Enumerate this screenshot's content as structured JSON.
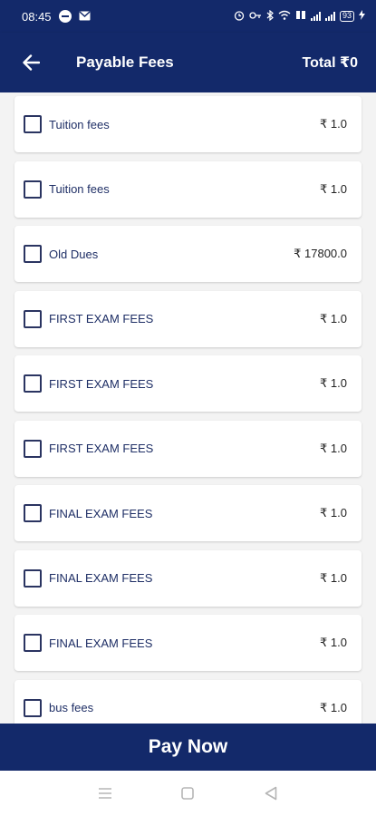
{
  "status_bar": {
    "time": "08:45",
    "battery": "93"
  },
  "header": {
    "title": "Payable Fees",
    "total": "Total ₹0"
  },
  "fees": [
    {
      "name": "Tuition fees",
      "amount": "₹ 1.0"
    },
    {
      "name": "Tuition fees",
      "amount": "₹ 1.0"
    },
    {
      "name": "Old Dues",
      "amount": "₹ 17800.0"
    },
    {
      "name": "FIRST EXAM FEES",
      "amount": "₹ 1.0"
    },
    {
      "name": "FIRST EXAM FEES",
      "amount": "₹ 1.0"
    },
    {
      "name": "FIRST EXAM FEES",
      "amount": "₹ 1.0"
    },
    {
      "name": "FINAL EXAM FEES",
      "amount": "₹ 1.0"
    },
    {
      "name": "FINAL EXAM FEES",
      "amount": "₹ 1.0"
    },
    {
      "name": "FINAL EXAM FEES",
      "amount": "₹ 1.0"
    },
    {
      "name": "bus fees",
      "amount": "₹ 1.0"
    }
  ],
  "footer": {
    "pay_label": "Pay Now"
  },
  "colors": {
    "primary": "#13296a",
    "background": "#f3f3f3"
  }
}
